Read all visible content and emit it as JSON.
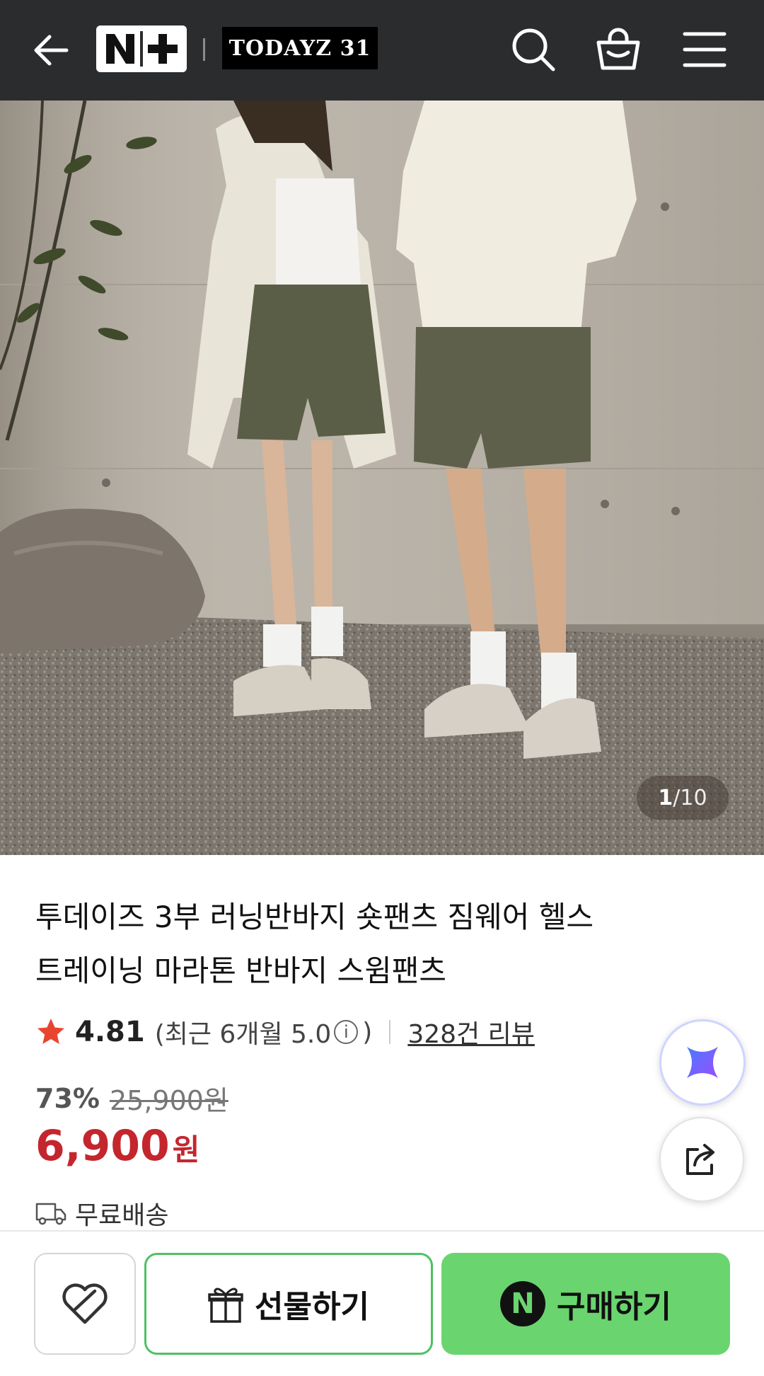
{
  "header": {
    "back_icon": "arrow-left-icon",
    "naver_plus_logo": "N+",
    "brand_logo": "TODAYZ 31",
    "search_icon": "search-icon",
    "cart_icon": "shopping-bag-icon",
    "menu_icon": "hamburger-menu-icon"
  },
  "gallery": {
    "current": "1",
    "separator": "/",
    "total": "10"
  },
  "product": {
    "title_line1": "투데이즈 3부 러닝반바지 숏팬츠 짐웨어 헬스",
    "title_line2": "트레이닝 마라톤 반바지 스윔팬츠",
    "rating": "4.81",
    "recent_prefix": "(최근 6개월 5.0",
    "recent_suffix": ")",
    "info_glyph": "i",
    "review_count": "328건 리뷰",
    "discount": "73%",
    "original_price": "25,900원",
    "price": "6,900",
    "currency": "원",
    "shipping": "무료배송"
  },
  "actions": {
    "gift_label": "선물하기",
    "buy_label": "구매하기",
    "buy_badge": "N"
  },
  "colors": {
    "header_bg": "#2b2c2e",
    "price_red": "#c4262e",
    "buy_green": "#6ad56f",
    "gift_border": "#4fc163",
    "star": "#e8452f"
  }
}
